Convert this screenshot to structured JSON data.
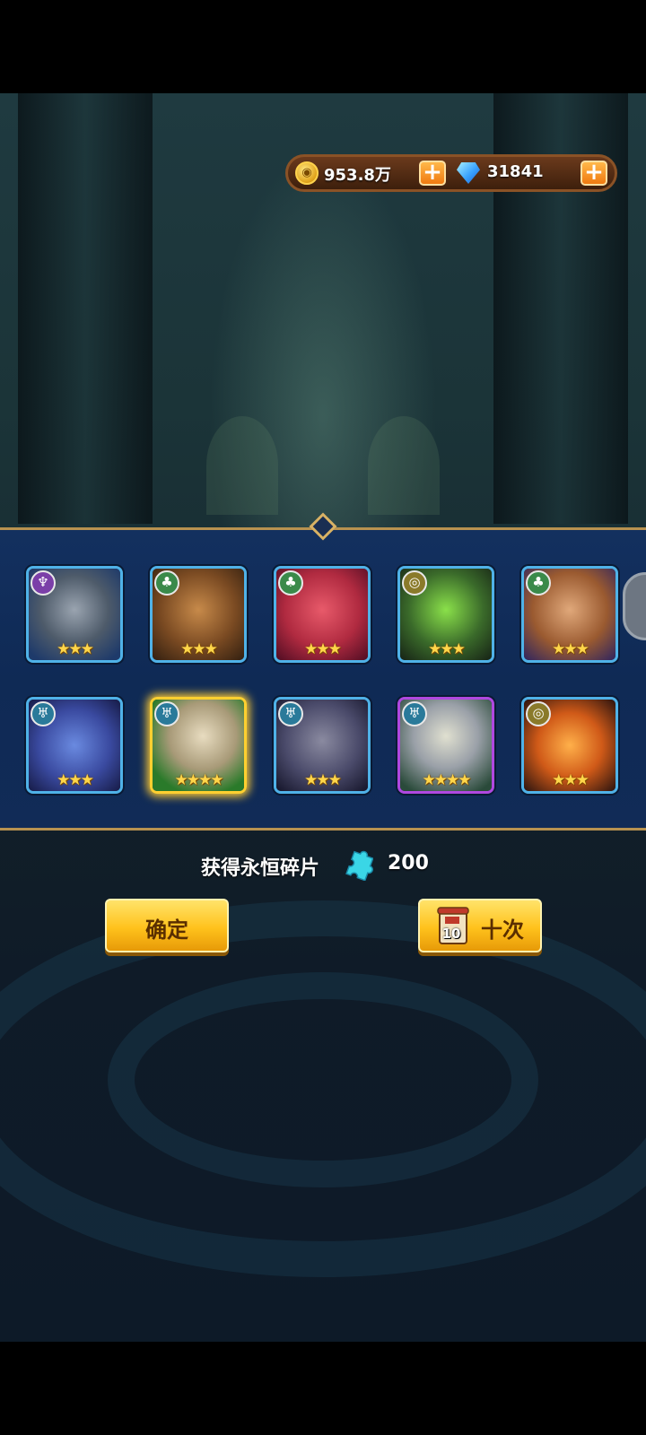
{
  "currency": {
    "gold": "953.8万",
    "gems": "31841"
  },
  "heroes": [
    {
      "name_icon": "armored-knight-hero",
      "faction_icon": "shadow-faction-icon",
      "stars": "★★★",
      "rarity": "blue"
    },
    {
      "name_icon": "werewolf-hero",
      "faction_icon": "nature-faction-icon",
      "stars": "★★★",
      "rarity": "blue"
    },
    {
      "name_icon": "red-bird-hero",
      "faction_icon": "nature-faction-icon",
      "stars": "★★★",
      "rarity": "blue"
    },
    {
      "name_icon": "green-golem-hero",
      "faction_icon": "fortress-faction-icon",
      "stars": "★★★",
      "rarity": "blue"
    },
    {
      "name_icon": "monkey-warrior-hero",
      "faction_icon": "nature-faction-icon",
      "stars": "★★★",
      "rarity": "blue"
    },
    {
      "name_icon": "troll-hero",
      "faction_icon": "abyss-faction-icon",
      "stars": "★★★",
      "rarity": "blue"
    },
    {
      "name_icon": "skull-mask-hero",
      "faction_icon": "abyss-faction-icon",
      "stars": "★★★★",
      "rarity": "gold"
    },
    {
      "name_icon": "zombie-hero",
      "faction_icon": "abyss-faction-icon",
      "stars": "★★★",
      "rarity": "blue"
    },
    {
      "name_icon": "skeleton-lich-hero",
      "faction_icon": "abyss-faction-icon",
      "stars": "★★★★",
      "rarity": "purple"
    },
    {
      "name_icon": "fire-beast-hero",
      "faction_icon": "fortress-faction-icon",
      "stars": "★★★",
      "rarity": "blue"
    }
  ],
  "reward": {
    "label": "获得永恒碎片",
    "amount": "200"
  },
  "buttons": {
    "confirm": "确定",
    "ten_draw": "十次",
    "ten_ticket_number": "10"
  },
  "colors": {
    "panel_blue": "#0f2a55",
    "card_border_blue": "#4fb2e8",
    "card_border_gold": "#ffd030",
    "card_border_purple": "#b048e0",
    "button_gold": "#ffc21c"
  }
}
